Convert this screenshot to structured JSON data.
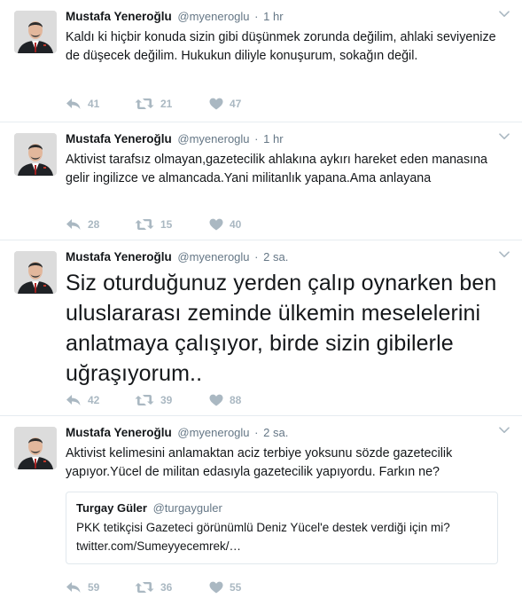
{
  "tweets": [
    {
      "fullname": "Mustafa Yeneroğlu",
      "username": "@myeneroglu",
      "separator": "·",
      "time": "1 hr",
      "text": "Kaldı ki hiçbir konuda sizin gibi düşünmek zorunda değilim, ahlaki seviyenize de düşecek değilim. Hukukun diliyle konuşurum, sokağın değil.",
      "replies": "41",
      "retweets": "21",
      "likes": "47"
    },
    {
      "fullname": "Mustafa Yeneroğlu",
      "username": "@myeneroglu",
      "separator": "·",
      "time": "1 hr",
      "text": "Aktivist tarafsız olmayan,gazetecilik ahlakına aykırı hareket eden manasına gelir ingilizce ve almancada.Yani militanlık yapana.Ama anlayana",
      "replies": "28",
      "retweets": "15",
      "likes": "40"
    },
    {
      "fullname": "Mustafa Yeneroğlu",
      "username": "@myeneroglu",
      "separator": "·",
      "time": "2 sa.",
      "text": "Siz oturduğunuz yerden çalıp oynarken ben uluslararası zeminde ülkemin meselelerini anlatmaya çalışıyor, birde sizin gibilerle uğraşıyorum..",
      "replies": "42",
      "retweets": "39",
      "likes": "88"
    },
    {
      "fullname": "Mustafa Yeneroğlu",
      "username": "@myeneroglu",
      "separator": "·",
      "time": "2 sa.",
      "text": "Aktivist kelimesini anlamaktan aciz terbiye yoksunu sözde gazetecilik yapıyor.Yücel de militan edasıyla gazetecilik yapıyordu. Farkın ne?",
      "quote": {
        "name": "Turgay Güler",
        "username": "@turgayguler",
        "text": "PKK tetikçisi Gazeteci görünümlü Deniz Yücel'e destek verdiği için mi?\ntwitter.com/Sumeyyecemrek/…"
      },
      "replies": "59",
      "retweets": "36",
      "likes": "55"
    }
  ],
  "icons": {
    "reply": "reply-icon",
    "retweet": "retweet-icon",
    "like": "heart-icon",
    "caret": "chevron-down-icon"
  },
  "colors": {
    "icon": "#aab8c2",
    "secondary_text": "#657786",
    "border": "#e6ecf0"
  }
}
